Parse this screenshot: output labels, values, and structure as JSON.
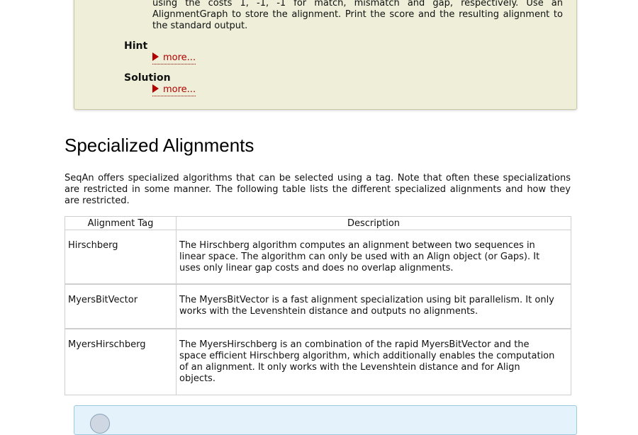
{
  "assignment": {
    "text_lines": [
      "using the costs 1, -1, -1 for match, mismatch and gap, respectively. Use an",
      "AlignmentGraph to store the alignment. Print the score and the resulting alignment to",
      "the standard output."
    ],
    "hint_label": "Hint",
    "solution_label": "Solution",
    "more_label": "more..."
  },
  "section": {
    "title": "Specialized Alignments",
    "intro_lines": [
      "SeqAn offers specialized algorithms that can be selected using a tag. Note that often these specializations",
      "are restricted in some manner. The following table lists the different specialized alignments and how they",
      "are restricted."
    ]
  },
  "table": {
    "headers": [
      "Alignment Tag",
      "Description"
    ],
    "rows": [
      {
        "tag": "Hirschberg",
        "desc_lines": [
          "The Hirschberg algorithm computes an alignment between two sequences in",
          "linear space. The algorithm can only be used with an Align object (or Gaps). It",
          "uses only linear gap costs and does no overlap alignments."
        ]
      },
      {
        "tag": "MyersBitVector",
        "desc_lines": [
          "The MyersBitVector is a fast alignment specialization using bit parallelism. It only",
          "works with the Levenshtein distance and outputs no alignments."
        ]
      },
      {
        "tag": "MyersHirschberg",
        "desc_lines": [
          "The MyersHirschberg is an combination of the rapid MyersBitVector and the",
          "space efficient Hirschberg algorithm, which additionally enables the computation",
          "of an alignment. It only works with the Levenshtein distance and for Align",
          "objects."
        ]
      }
    ]
  },
  "colors": {
    "assignment_bg": "#eeeed9",
    "link": "#b20000",
    "note_bg": "#e3f2fb"
  }
}
